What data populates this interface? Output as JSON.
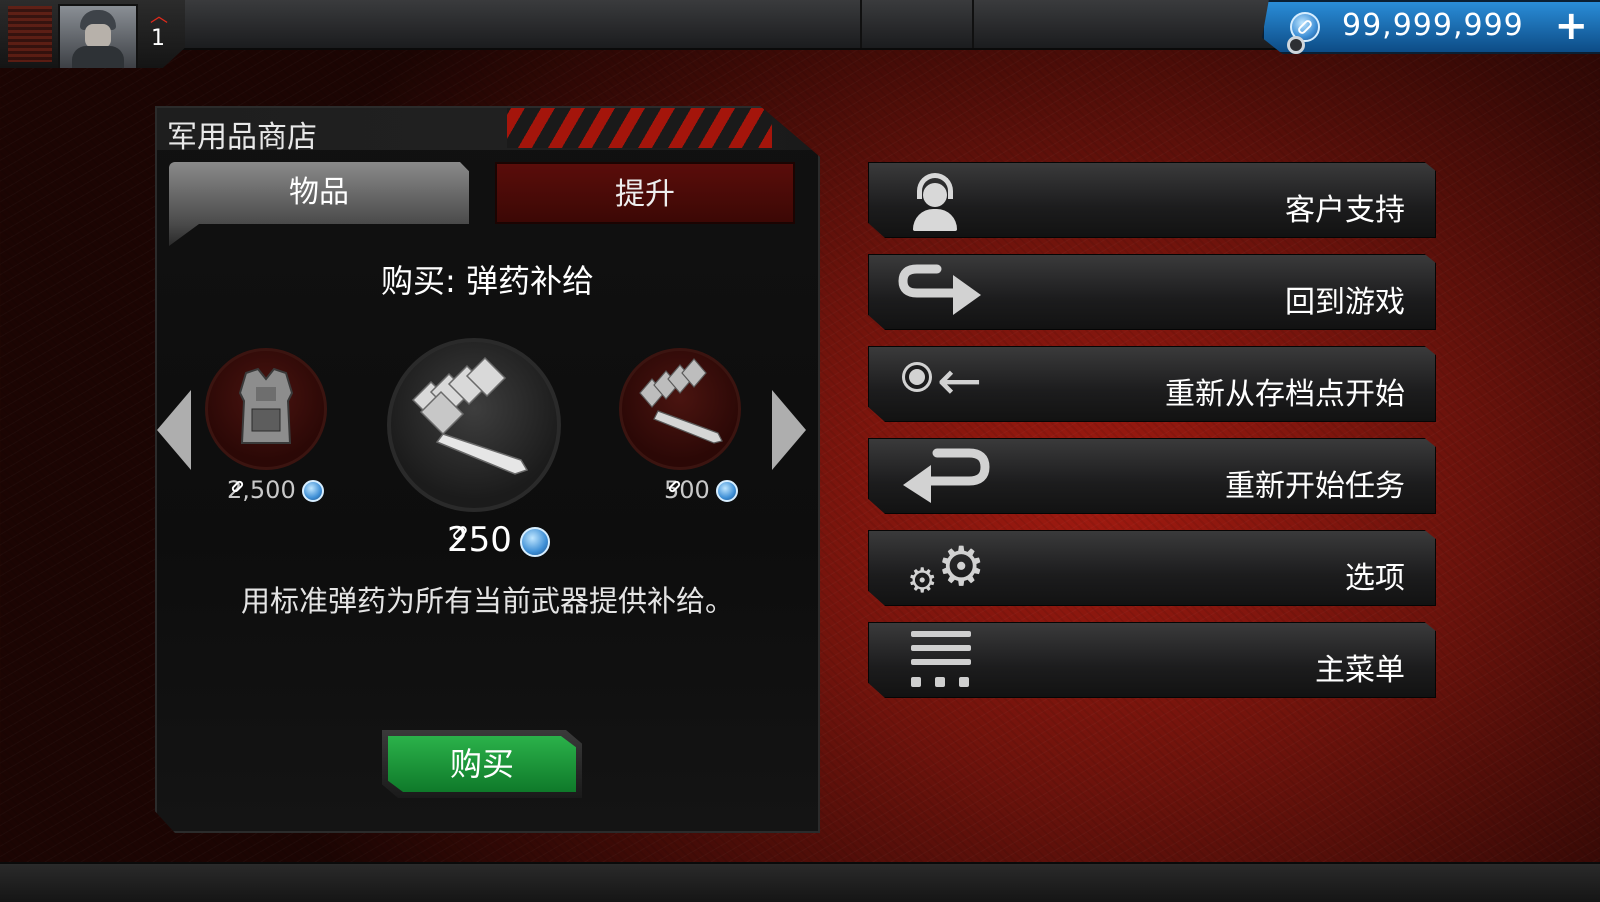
{
  "topbar": {
    "rank_level": "1",
    "currency_amount": "99,999,999",
    "add_currency_symbol": "+"
  },
  "shop": {
    "title": "军用品商店",
    "tabs": [
      {
        "label": "物品",
        "active": true
      },
      {
        "label": "提升",
        "active": false
      }
    ],
    "purchase_title": "购买: 弹药补给",
    "items": [
      {
        "icon": "body-armor-icon",
        "price": "2,500"
      },
      {
        "icon": "ammo-supply-icon",
        "price": "250",
        "selected": true
      },
      {
        "icon": "ammo-clip-icon",
        "price": "500"
      }
    ],
    "description": "用标准弹药为所有当前武器提供补给。",
    "buy_label": "购买"
  },
  "menu": [
    {
      "icon": "headset-icon",
      "label": "客户支持"
    },
    {
      "icon": "return-arrow-icon",
      "label": "回到游戏"
    },
    {
      "icon": "checkpoint-back-icon",
      "label": "重新从存档点开始"
    },
    {
      "icon": "restart-arrow-icon",
      "label": "重新开始任务"
    },
    {
      "icon": "gears-icon",
      "label": "选项"
    },
    {
      "icon": "menu-lines-icon",
      "label": "主菜单"
    }
  ],
  "colors": {
    "background_red": "#8e160d",
    "currency_blue": "#1f78c0",
    "buy_green": "#1c9a3a",
    "tab_upgrade_red": "#4c0b08"
  }
}
